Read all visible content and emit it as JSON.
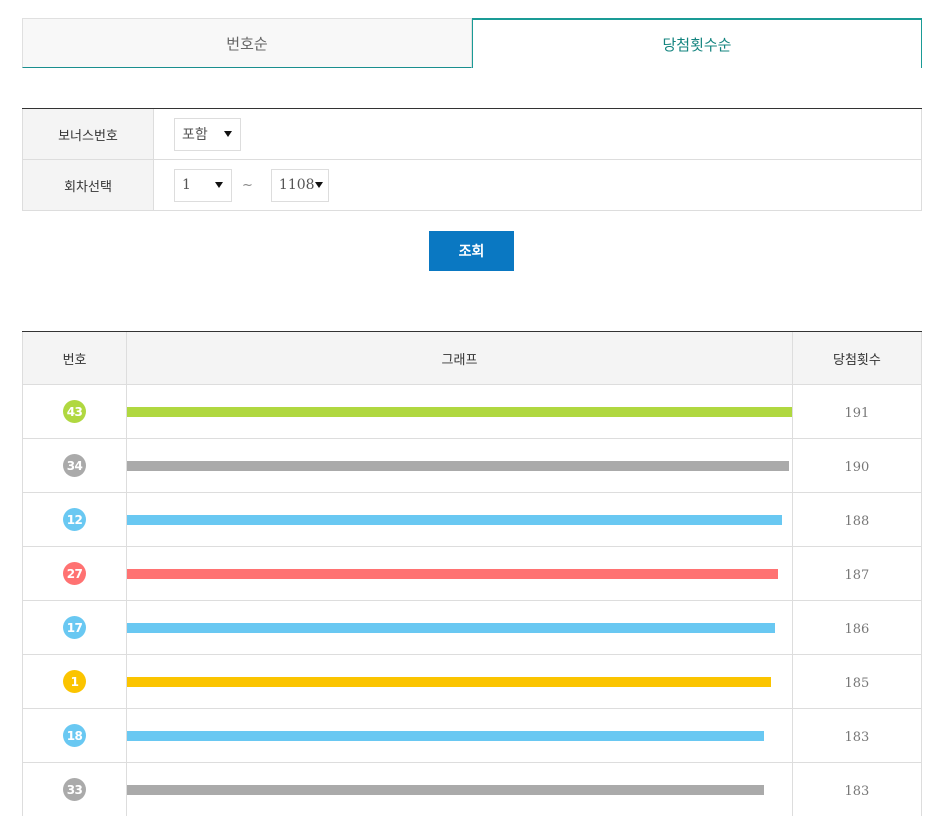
{
  "tabs": [
    {
      "label": "번호순",
      "active": false
    },
    {
      "label": "당첨횟수순",
      "active": true
    }
  ],
  "filter": {
    "bonus": {
      "label": "보너스번호",
      "value": "포함"
    },
    "round": {
      "label": "회차선택",
      "from": "1",
      "separator": "~",
      "to": "1108"
    }
  },
  "search_button": "조회",
  "table": {
    "headers": {
      "number": "번호",
      "graph": "그래프",
      "count": "당첨횟수"
    },
    "max_count": 191,
    "rows": [
      {
        "number": "43",
        "count": "191",
        "color": "#b0d840"
      },
      {
        "number": "34",
        "count": "190",
        "color": "#aaaaaa"
      },
      {
        "number": "12",
        "count": "188",
        "color": "#69c8f2"
      },
      {
        "number": "27",
        "count": "187",
        "color": "#ff7272"
      },
      {
        "number": "17",
        "count": "186",
        "color": "#69c8f2"
      },
      {
        "number": "1",
        "count": "185",
        "color": "#fbc400"
      },
      {
        "number": "18",
        "count": "183",
        "color": "#69c8f2"
      },
      {
        "number": "33",
        "count": "183",
        "color": "#aaaaaa"
      }
    ]
  },
  "colors": {
    "accent": "#1a9b96",
    "button": "#0a78c2"
  }
}
